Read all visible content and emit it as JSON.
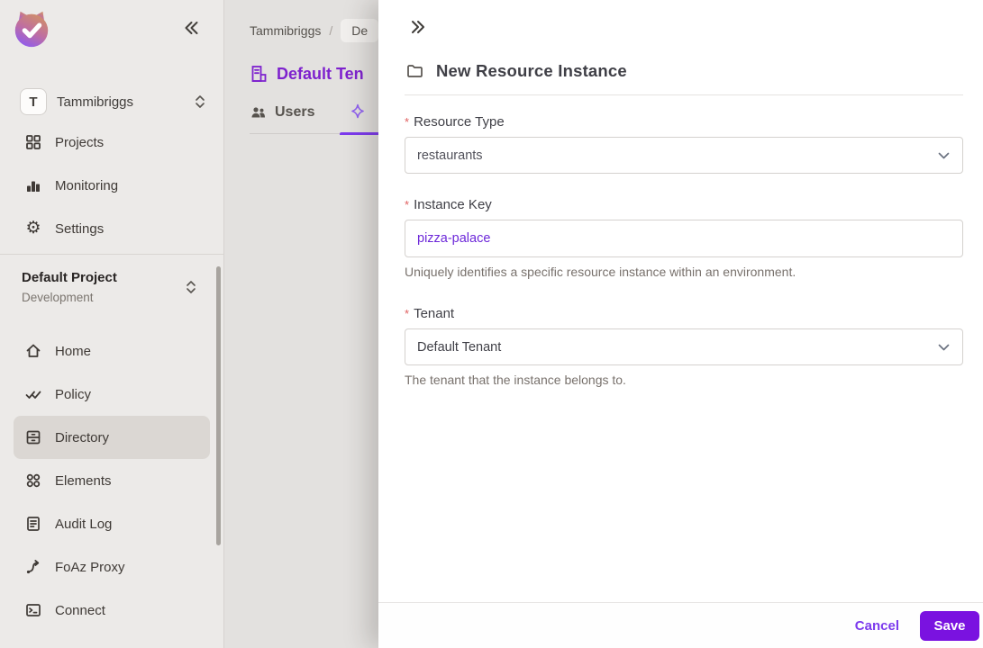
{
  "colors": {
    "brand_purple": "#7e22ce",
    "accent_purple": "#7c3aed",
    "save_button": "#7a12e0",
    "instance_key_text": "#6d28d9",
    "required_asterisk": "#e05f5f",
    "sidebar_bg": "#eceae8",
    "main_bg": "#e3e1df",
    "active_item_bg": "#dbd7d3"
  },
  "sidebar": {
    "workspace": {
      "avatar_initial": "T",
      "name": "Tammibriggs"
    },
    "top_items": [
      {
        "label": "Projects",
        "icon": "grid-icon"
      },
      {
        "label": "Monitoring",
        "icon": "bar-chart-icon"
      },
      {
        "label": "Settings",
        "icon": "gear-icon"
      }
    ],
    "project_switcher": {
      "project": "Default Project",
      "environment": "Development"
    },
    "menu_items": [
      {
        "label": "Home",
        "icon": "home-icon",
        "active": false
      },
      {
        "label": "Policy",
        "icon": "double-check-icon",
        "active": false
      },
      {
        "label": "Directory",
        "icon": "cabinet-icon",
        "active": true
      },
      {
        "label": "Elements",
        "icon": "circles-icon",
        "active": false
      },
      {
        "label": "Audit Log",
        "icon": "document-icon",
        "active": false
      },
      {
        "label": "FoAz Proxy",
        "icon": "route-arrow-icon",
        "active": false
      },
      {
        "label": "Connect",
        "icon": "terminal-icon",
        "active": false
      }
    ]
  },
  "main": {
    "breadcrumb": {
      "root": "Tammibriggs",
      "separator": "/",
      "current_truncated": "De"
    },
    "page_title_truncated": "Default Ten",
    "tabs": [
      {
        "label": "Users",
        "icon": "users-icon",
        "active": false
      },
      {
        "label": "",
        "icon": "sparkle-icon",
        "active": true
      }
    ]
  },
  "panel": {
    "title": "New Resource Instance",
    "required_marker": "*",
    "fields": [
      {
        "label": "Resource Type",
        "control": "select",
        "value": "restaurants",
        "helper": ""
      },
      {
        "label": "Instance Key",
        "control": "text",
        "value": "pizza-palace",
        "helper": "Uniquely identifies a specific resource instance within an environment."
      },
      {
        "label": "Tenant",
        "control": "select",
        "value": "Default Tenant",
        "helper": "The tenant that the instance belongs to."
      }
    ],
    "footer": {
      "cancel_label": "Cancel",
      "save_label": "Save"
    }
  }
}
